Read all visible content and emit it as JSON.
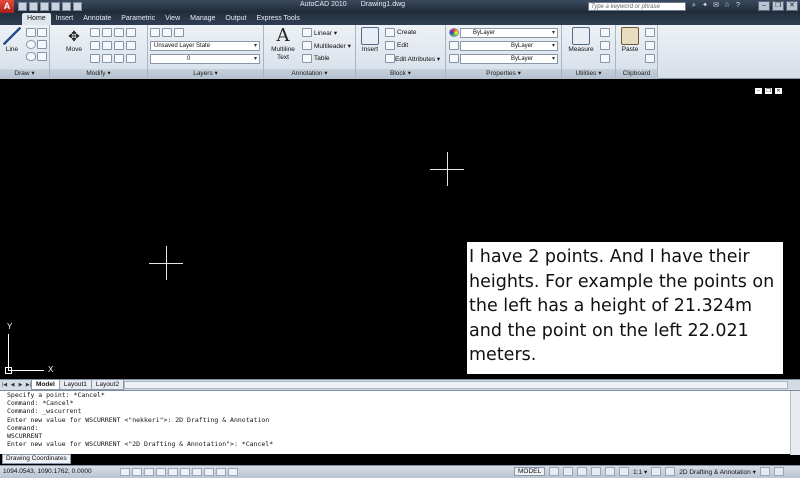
{
  "app": {
    "app_button": "A",
    "title": "AutoCAD 2010",
    "document": "Drawing1.dwg",
    "search_placeholder": "Type a keyword or phrase"
  },
  "ribbon_tabs": [
    "Home",
    "Insert",
    "Annotate",
    "Parametric",
    "View",
    "Manage",
    "Output",
    "Express Tools"
  ],
  "panels": {
    "draw": {
      "label": "Draw ▾",
      "line": "Line"
    },
    "modify": {
      "label": "Modify ▾",
      "move": "Move"
    },
    "layers": {
      "label": "Layers ▾",
      "layer_state": "Unsaved Layer State",
      "current_layer": "0"
    },
    "annotation": {
      "label": "Annotation ▾",
      "mtext_line1": "Multiline",
      "mtext_line2": "Text",
      "linear": "Linear ▾",
      "multileader": "Multileader ▾",
      "table": "Table"
    },
    "block": {
      "label": "Block ▾",
      "insert": "Insert",
      "create": "Create",
      "edit": "Edit",
      "edit_attributes": "Edit Attributes ▾"
    },
    "properties": {
      "label": "Properties ▾",
      "color": "ByLayer",
      "linetype": "ByLayer",
      "lineweight": "ByLayer"
    },
    "utilities": {
      "label": "Utilities ▾",
      "measure": "Measure"
    },
    "clipboard": {
      "label": "Clipboard",
      "paste": "Paste"
    }
  },
  "annotation_text": "I have 2 points. And I have their heights. For example the points on the left has a height of 21.324m and the point on the left 22.021 meters.",
  "ucs": {
    "x": "X",
    "y": "Y"
  },
  "layout_tabs": [
    "Model",
    "Layout1",
    "Layout2"
  ],
  "command_history": [
    "Specify a point: *Cancel*",
    "Command: *Cancel*",
    "Command: _wscurrent",
    "Enter new value for WSCURRENT <\"nekkeri\">: 2D Drafting & Annotation",
    "Command:",
    "WSCURRENT",
    "Enter new value for WSCURRENT <\"2D Drafting & Annotation\">: *Cancel*"
  ],
  "coord_tip": "Drawing Coordinates",
  "status": {
    "coordinates": "1094.0543, 1090.1762, 0.0000",
    "model": "MODEL",
    "scale": "1:1 ▾",
    "workspace": "2D Drafting & Annotation ▾"
  }
}
